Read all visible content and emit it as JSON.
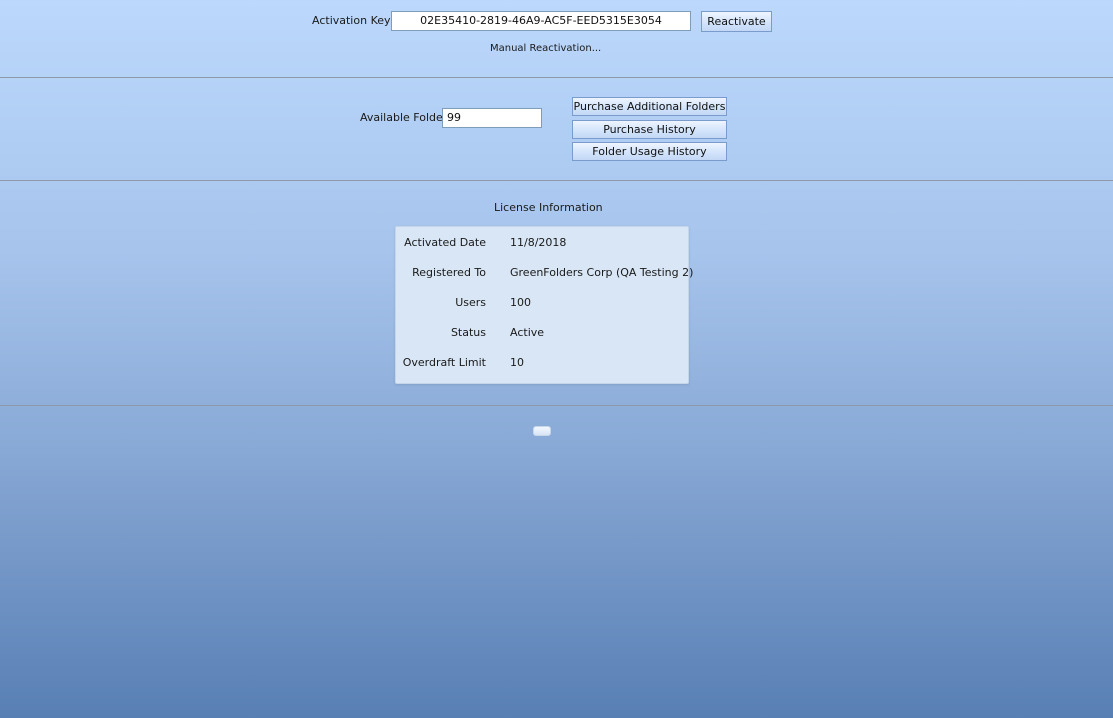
{
  "activation": {
    "key_label": "Activation Key",
    "key_value": "02E35410-2819-46A9-AC5F-EED5315E3054",
    "reactivate_label": "Reactivate",
    "manual_link": "Manual Reactivation..."
  },
  "folders": {
    "available_label": "Available Folders",
    "available_value": "99",
    "purchase_additional_label": "Purchase Additional Folders",
    "purchase_history_label": "Purchase History",
    "usage_history_label": "Folder Usage History"
  },
  "license": {
    "title": "License Information",
    "rows": [
      {
        "label": "Activated Date",
        "value": "11/8/2018"
      },
      {
        "label": "Registered To",
        "value": "GreenFolders Corp (QA Testing 2)"
      },
      {
        "label": "Users",
        "value": "100"
      },
      {
        "label": "Status",
        "value": "Active"
      },
      {
        "label": "Overdraft Limit",
        "value": "10"
      }
    ]
  },
  "colors": {
    "bg_top": "#bcd8fc",
    "bg_bottom": "#587fb4",
    "panel": "#d8e6f5",
    "divider": "#8d99a8"
  }
}
